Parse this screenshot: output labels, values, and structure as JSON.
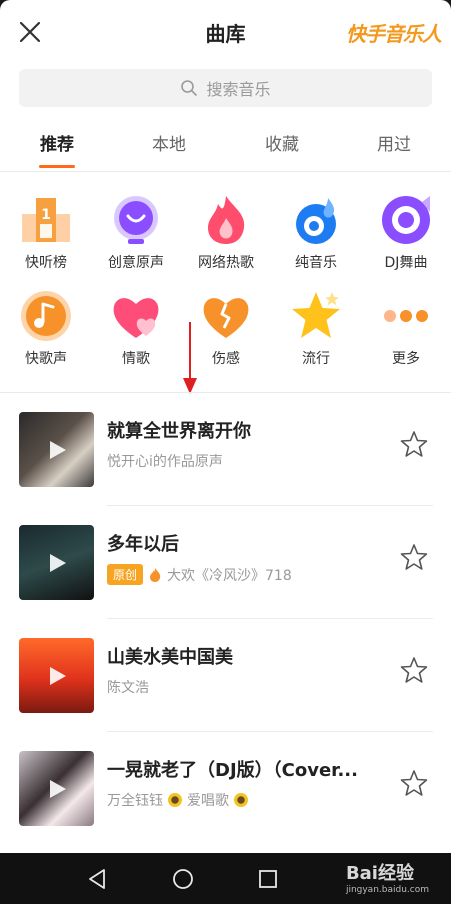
{
  "header": {
    "title": "曲库",
    "brand": "快手音乐人"
  },
  "search": {
    "placeholder": "搜索音乐"
  },
  "tabs": [
    {
      "label": "推荐",
      "active": true
    },
    {
      "label": "本地",
      "active": false
    },
    {
      "label": "收藏",
      "active": false
    },
    {
      "label": "用过",
      "active": false
    }
  ],
  "categories": [
    {
      "label": "快听榜",
      "icon": "podium-icon"
    },
    {
      "label": "创意原声",
      "icon": "smile-bulb-icon"
    },
    {
      "label": "网络热歌",
      "icon": "flame-icon"
    },
    {
      "label": "纯音乐",
      "icon": "droplet-icon"
    },
    {
      "label": "DJ舞曲",
      "icon": "vinyl-icon"
    },
    {
      "label": "快歌声",
      "icon": "music-note-icon"
    },
    {
      "label": "情歌",
      "icon": "hearts-icon"
    },
    {
      "label": "伤感",
      "icon": "broken-heart-icon"
    },
    {
      "label": "流行",
      "icon": "star-icon"
    },
    {
      "label": "更多",
      "icon": "more-dots-icon"
    }
  ],
  "songs": [
    {
      "title": "就算全世界离开你",
      "subtitle": "悦开心i的作品原声",
      "badge": "",
      "fire": false
    },
    {
      "title": "多年以后",
      "badge": "原创",
      "subtitle": "大欢《冷风沙》718",
      "fire": true
    },
    {
      "title": "山美水美中国美",
      "subtitle": "陈文浩",
      "badge": "",
      "fire": false
    },
    {
      "title": "一晃就老了（DJ版）（Cover...",
      "subtitle_a": "万全钰钰",
      "subtitle_b": "爱唱歌",
      "badge": "",
      "fire": false
    }
  ],
  "watermark": {
    "main": "Bai经验",
    "sub": "jingyan.baidu.com"
  },
  "colors": {
    "accent": "#ff6a1a",
    "brand": "#f39a1e",
    "badge": "#f7a423"
  }
}
